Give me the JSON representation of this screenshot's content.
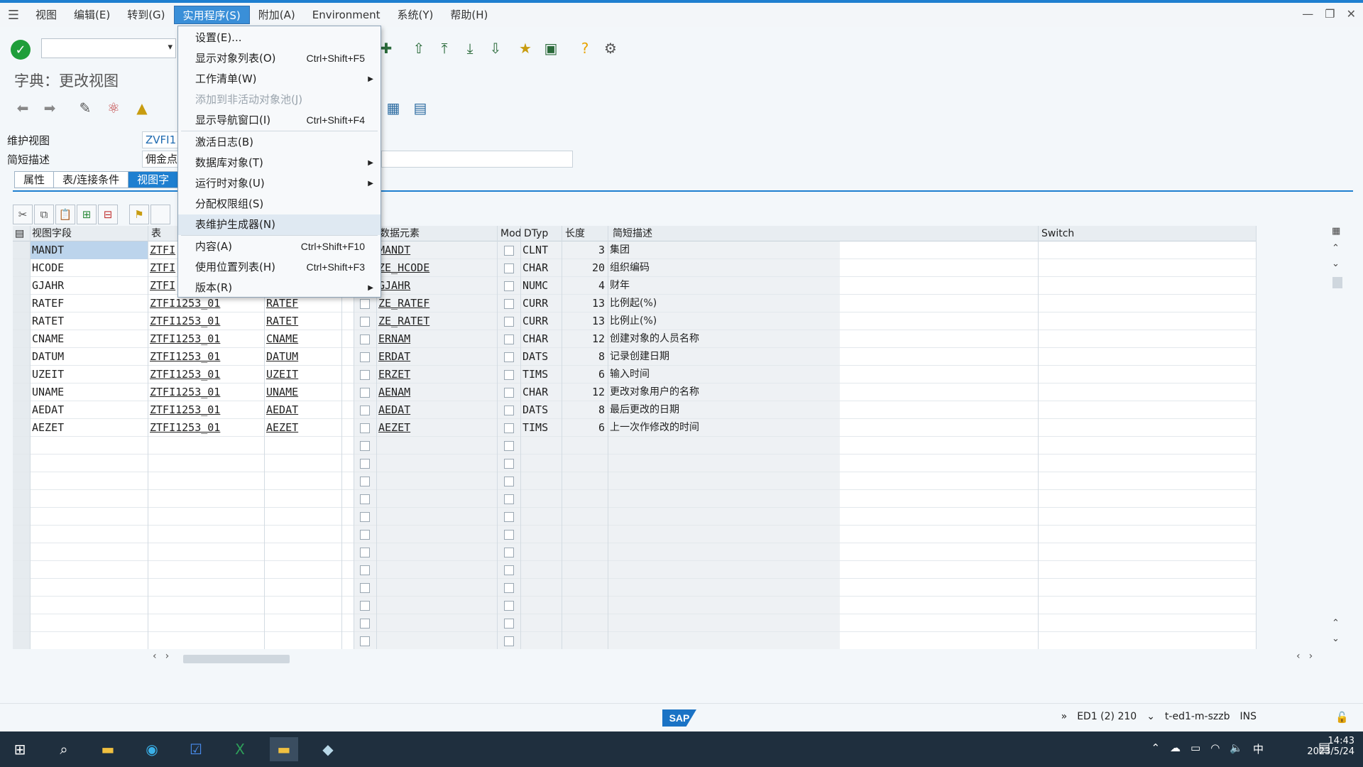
{
  "menubar": {
    "items": [
      "视图",
      "编辑(E)",
      "转到(G)",
      "实用程序(S)",
      "附加(A)",
      "Environment",
      "系统(Y)",
      "帮助(H)"
    ]
  },
  "title": "字典：更改视图",
  "fields": {
    "maintenance_view_label": "维护视图",
    "maintenance_view_value": "ZVFI1",
    "short_desc_label": "简短描述",
    "short_desc_value": "佣金点"
  },
  "tabs": [
    "属性",
    "表/连接条件",
    "视图字"
  ],
  "grid": {
    "headers": {
      "view_field": "视图字段",
      "table": "表",
      "data_element": "数据元素",
      "mod": "Mod",
      "dtyp": "DTyp",
      "length": "长度",
      "short_desc": "简短描述",
      "switch": "Switch"
    },
    "rows": [
      {
        "view_field": "MANDT",
        "table": "ZTFI",
        "field": "",
        "data_element": "MANDT",
        "dtyp": "CLNT",
        "length": "3",
        "desc": "集团"
      },
      {
        "view_field": "HCODE",
        "table": "ZTFI",
        "field": "",
        "data_element": "ZE_HCODE",
        "dtyp": "CHAR",
        "length": "20",
        "desc": "组织编码"
      },
      {
        "view_field": "GJAHR",
        "table": "ZTFI",
        "field": "",
        "data_element": "GJAHR",
        "dtyp": "NUMC",
        "length": "4",
        "desc": "财年"
      },
      {
        "view_field": "RATEF",
        "table": "ZTFI1253_01",
        "field": "RATEF",
        "data_element": "ZE_RATEF",
        "dtyp": "CURR",
        "length": "13",
        "desc": "比例起(%)"
      },
      {
        "view_field": "RATET",
        "table": "ZTFI1253_01",
        "field": "RATET",
        "data_element": "ZE_RATET",
        "dtyp": "CURR",
        "length": "13",
        "desc": "比例止(%)"
      },
      {
        "view_field": "CNAME",
        "table": "ZTFI1253_01",
        "field": "CNAME",
        "data_element": "ERNAM",
        "dtyp": "CHAR",
        "length": "12",
        "desc": "创建对象的人员名称"
      },
      {
        "view_field": "DATUM",
        "table": "ZTFI1253_01",
        "field": "DATUM",
        "data_element": "ERDAT",
        "dtyp": "DATS",
        "length": "8",
        "desc": "记录创建日期"
      },
      {
        "view_field": "UZEIT",
        "table": "ZTFI1253_01",
        "field": "UZEIT",
        "data_element": "ERZET",
        "dtyp": "TIMS",
        "length": "6",
        "desc": "输入时间"
      },
      {
        "view_field": "UNAME",
        "table": "ZTFI1253_01",
        "field": "UNAME",
        "data_element": "AENAM",
        "dtyp": "CHAR",
        "length": "12",
        "desc": "更改对象用户的名称"
      },
      {
        "view_field": "AEDAT",
        "table": "ZTFI1253_01",
        "field": "AEDAT",
        "data_element": "AEDAT",
        "dtyp": "DATS",
        "length": "8",
        "desc": "最后更改的日期"
      },
      {
        "view_field": "AEZET",
        "table": "ZTFI1253_01",
        "field": "AEZET",
        "data_element": "AEZET",
        "dtyp": "TIMS",
        "length": "6",
        "desc": "上一次作修改的时间"
      }
    ]
  },
  "dropdown": {
    "items": [
      {
        "label": "设置(E)...",
        "shortcut": "",
        "submenu": false,
        "disabled": false
      },
      {
        "label": "显示对象列表(O)",
        "shortcut": "Ctrl+Shift+F5",
        "submenu": false,
        "disabled": false
      },
      {
        "label": "工作清单(W)",
        "shortcut": "",
        "submenu": true,
        "disabled": false
      },
      {
        "label": "添加到非活动对象池(J)",
        "shortcut": "",
        "submenu": false,
        "disabled": true
      },
      {
        "label": "显示导航窗口(I)",
        "shortcut": "Ctrl+Shift+F4",
        "submenu": false,
        "disabled": false
      },
      {
        "label": "激活日志(B)",
        "shortcut": "",
        "submenu": false,
        "disabled": false
      },
      {
        "label": "数据库对象(T)",
        "shortcut": "",
        "submenu": true,
        "disabled": false
      },
      {
        "label": "运行时对象(U)",
        "shortcut": "",
        "submenu": true,
        "disabled": false
      },
      {
        "label": "分配权限组(S)",
        "shortcut": "",
        "submenu": false,
        "disabled": false
      },
      {
        "label": "表维护生成器(N)",
        "shortcut": "",
        "submenu": false,
        "disabled": false
      },
      {
        "label": "内容(A)",
        "shortcut": "Ctrl+Shift+F10",
        "submenu": false,
        "disabled": false
      },
      {
        "label": "使用位置列表(H)",
        "shortcut": "Ctrl+Shift+F3",
        "submenu": false,
        "disabled": false
      },
      {
        "label": "版本(R)",
        "shortcut": "",
        "submenu": true,
        "disabled": false
      }
    ]
  },
  "status": {
    "system": "ED1 (2) 210",
    "server": "t-ed1-m-szzb",
    "mode": "INS"
  },
  "taskbar": {
    "time": "14:43",
    "date": "2023/5/24",
    "ime": "中"
  }
}
